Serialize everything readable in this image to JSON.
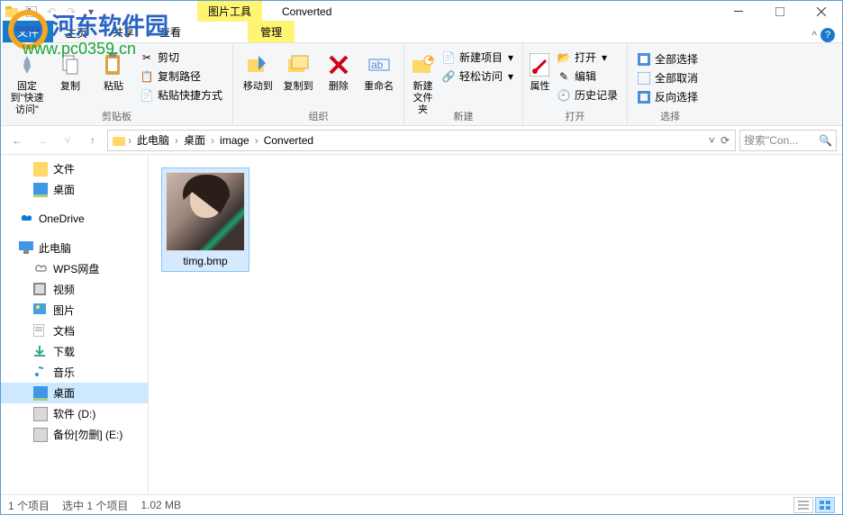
{
  "watermark": {
    "brand": "河东软件园",
    "url": "www.pc0359.cn"
  },
  "titlebar": {
    "contextual_tab": "图片工具",
    "title": "Converted"
  },
  "tabs": {
    "file": "文件",
    "home": "主页",
    "share": "共享",
    "view": "查看",
    "manage": "管理"
  },
  "ribbon": {
    "clipboard": {
      "label": "剪贴板",
      "pin": "固定到\"快速访问\"",
      "copy": "复制",
      "paste": "粘贴",
      "cut": "剪切",
      "copy_path": "复制路径",
      "paste_shortcut": "粘贴快捷方式"
    },
    "organize": {
      "label": "组织",
      "move_to": "移动到",
      "copy_to": "复制到",
      "delete": "删除",
      "rename": "重命名"
    },
    "new": {
      "label": "新建",
      "new_folder": "新建文件夹",
      "new_item": "新建项目",
      "easy_access": "轻松访问"
    },
    "open": {
      "label": "打开",
      "properties": "属性",
      "open": "打开",
      "edit": "编辑",
      "history": "历史记录"
    },
    "select": {
      "label": "选择",
      "select_all": "全部选择",
      "select_none": "全部取消",
      "invert": "反向选择"
    }
  },
  "breadcrumbs": {
    "c0": "此电脑",
    "c1": "桌面",
    "c2": "image",
    "c3": "Converted"
  },
  "search": {
    "placeholder": "搜索\"Con..."
  },
  "sidebar": {
    "files": "文件",
    "desktop1": "桌面",
    "onedrive": "OneDrive",
    "thispc": "此电脑",
    "wps": "WPS网盘",
    "videos": "视频",
    "pictures": "图片",
    "documents": "文档",
    "downloads": "下载",
    "music": "音乐",
    "desktop2": "桌面",
    "drive_d": "软件 (D:)",
    "drive_e": "备份[勿删] (E:)"
  },
  "file": {
    "name": "timg.bmp"
  },
  "status": {
    "items": "1 个项目",
    "selected": "选中 1 个项目",
    "size": "1.02 MB"
  }
}
